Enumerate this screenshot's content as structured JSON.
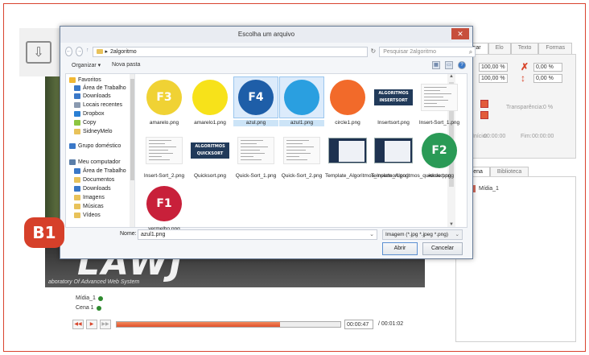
{
  "app": {
    "right_panel": {
      "tabs": [
        "Formar",
        "Elo",
        "Texto",
        "Formas"
      ],
      "scale_x": "100,00 %",
      "scale_y": "100,00 %",
      "rot_x": "0,00 %",
      "rot_y": "0,00 %",
      "transparency_label": "Transparência:",
      "transparency_value": "0 %",
      "start_label": "Início:",
      "start_value": "00:00:00",
      "end_label": "Fim:",
      "end_value": "00:00:00",
      "lib_tabs": [
        "da cena",
        "Biblioteca"
      ],
      "media_item": "Mídia_1"
    },
    "video": {
      "logo_text": "LAWJ",
      "subtitle": "aboratory Of Advanced Web System"
    },
    "timeline": {
      "track1": "Mídia_1",
      "track2": "Cena 1",
      "progress": 0.73,
      "current_time": "00:00:47",
      "total_time": "/ 00:01:02"
    }
  },
  "dialog": {
    "title": "Escolha um arquivo",
    "close_label": "✕",
    "path": "2algoritmo",
    "path_separator": "▸",
    "search_placeholder": "Pesquisar 2algoritmo",
    "organize_label": "Organizar ▾",
    "new_folder_label": "Nova pasta",
    "nav_items": [
      {
        "label": "Favoritos",
        "icon": "star-icon",
        "color": "#f1b833"
      },
      {
        "label": "Área de Trabalho",
        "icon": "desktop-icon",
        "color": "#3a78c8"
      },
      {
        "label": "Downloads",
        "icon": "downloads-icon",
        "color": "#3a78c8"
      },
      {
        "label": "Locais recentes",
        "icon": "recent-icon",
        "color": "#8a9ab0"
      },
      {
        "label": "Dropbox",
        "icon": "dropbox-icon",
        "color": "#2a7fd4"
      },
      {
        "label": "Copy",
        "icon": "copy-icon",
        "color": "#8cc540"
      },
      {
        "label": "SidneyMelo",
        "icon": "folder-icon",
        "color": "#e8c25a"
      },
      {
        "label": "Grupo doméstico",
        "icon": "homegroup-icon",
        "color": "#3a78c8"
      },
      {
        "label": "Meu computador",
        "icon": "computer-icon",
        "color": "#5a7ea8"
      },
      {
        "label": "Área de Trabalho",
        "icon": "desktop-icon",
        "color": "#3a78c8"
      },
      {
        "label": "Documentos",
        "icon": "documents-icon",
        "color": "#e8c25a"
      },
      {
        "label": "Downloads",
        "icon": "downloads-icon",
        "color": "#3a78c8"
      },
      {
        "label": "Imagens",
        "icon": "pictures-icon",
        "color": "#e8c25a"
      },
      {
        "label": "Músicas",
        "icon": "music-icon",
        "color": "#e8c25a"
      },
      {
        "label": "Vídeos",
        "icon": "videos-icon",
        "color": "#e8c25a"
      }
    ],
    "files": [
      {
        "name": "amarelo.png",
        "kind": "circle",
        "color": "#f0d234",
        "text": "F3",
        "selected": false
      },
      {
        "name": "amarelo1.png",
        "kind": "circle",
        "color": "#f7e21a",
        "text": "",
        "selected": false
      },
      {
        "name": "azul.png",
        "kind": "circle",
        "color": "#1e5ea8",
        "text": "F4",
        "selected": true
      },
      {
        "name": "azul1.png",
        "kind": "circle",
        "color": "#2a9fe0",
        "text": "",
        "selected": true
      },
      {
        "name": "circle1.png",
        "kind": "circle",
        "color": "#f26a2a",
        "text": "",
        "selected": false
      },
      {
        "name": "Insertsort.png",
        "kind": "banner",
        "color": "#213a5a",
        "text": "ALGORITMOS INSERTSORT",
        "selected": false
      },
      {
        "name": "Insert-Sort_1.png",
        "kind": "code",
        "color": "#fafafa",
        "text": "",
        "selected": false
      },
      {
        "name": "Insert-Sort_2.png",
        "kind": "code",
        "color": "#fafafa",
        "text": "",
        "selected": false
      },
      {
        "name": "Quicksort.png",
        "kind": "banner",
        "color": "#213a5a",
        "text": "ALGORITMOS QUICKSORT",
        "selected": false
      },
      {
        "name": "Quick-Sort_1.png",
        "kind": "code",
        "color": "#fafafa",
        "text": "",
        "selected": false
      },
      {
        "name": "Quick-Sort_2.png",
        "kind": "code",
        "color": "#fafafa",
        "text": "",
        "selected": false
      },
      {
        "name": "Template_Algoritmos_insertsort.png",
        "kind": "template",
        "color": "#1e3250",
        "text": "",
        "selected": false
      },
      {
        "name": "Template_Algoritmos_quicksort.png",
        "kind": "template",
        "color": "#1e3250",
        "text": "",
        "selected": false
      },
      {
        "name": "verde.png",
        "kind": "circle",
        "color": "#2a9a56",
        "text": "F2",
        "selected": false
      },
      {
        "name": "vermelho.png",
        "kind": "circle",
        "color": "#c8203a",
        "text": "F1",
        "selected": false
      }
    ],
    "name_label": "Nome:",
    "name_value": "azul1.png",
    "type_filter": "Imagem (*.jpg *.jpeg *.png)",
    "open_button": "Abrir",
    "cancel_button": "Cancelar"
  },
  "badge": "B1"
}
